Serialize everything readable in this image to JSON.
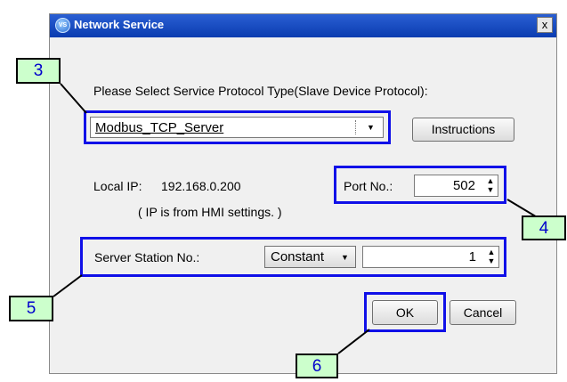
{
  "dialog": {
    "title": "Network Service",
    "close_label": "x",
    "app_icon": "vs-app-icon"
  },
  "protocol": {
    "prompt": "Please Select Service Protocol Type(Slave Device Protocol):",
    "selected": "Modbus_TCP_Server",
    "instructions_label": "Instructions"
  },
  "network": {
    "local_ip_label": "Local IP:",
    "local_ip_value": "192.168.0.200",
    "ip_note": "( IP is from HMI settings. )",
    "port_label": "Port No.:",
    "port_value": "502"
  },
  "station": {
    "label": "Server Station No.:",
    "mode": "Constant",
    "value": "1"
  },
  "buttons": {
    "ok": "OK",
    "cancel": "Cancel"
  },
  "callouts": {
    "c3": "3",
    "c4": "4",
    "c5": "5",
    "c6": "6"
  },
  "colors": {
    "title_bar": "#0a3cb0",
    "highlight": "#1010e8",
    "callout_fill": "#ccffcc",
    "callout_text": "#0000cc"
  }
}
